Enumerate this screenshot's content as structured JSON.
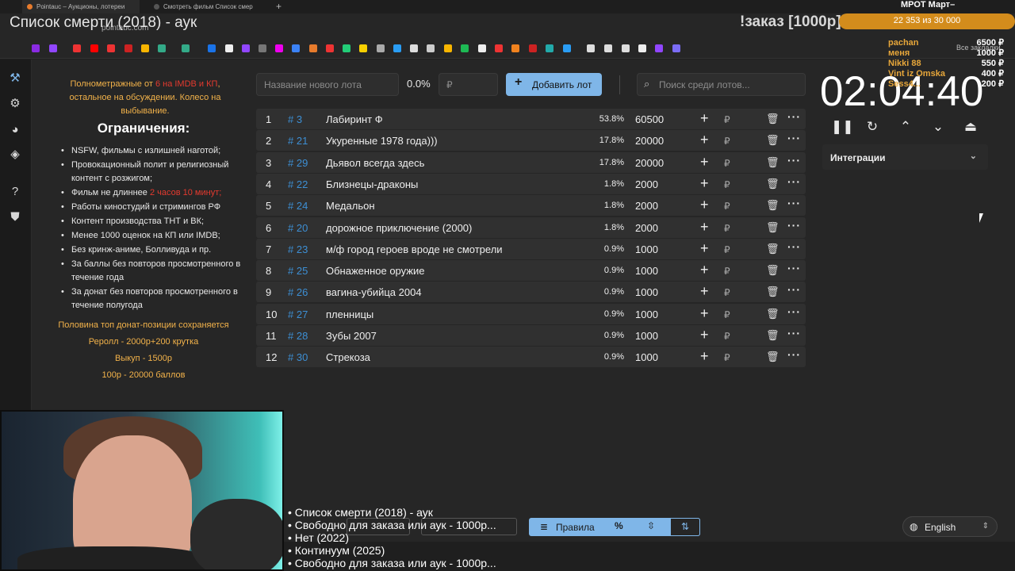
{
  "browser": {
    "tabs": [
      {
        "label": "Pointauc – Аукционы, лотереи"
      },
      {
        "label": "Смотреть фильм Список смер"
      }
    ],
    "url": "pointauc.com",
    "bookmarks_label": "Все закладки"
  },
  "overlay": {
    "page_title": "Список смерти (2018) - аук",
    "order": "!заказ [1000р]",
    "goal": "22 353  из 30 000",
    "mrot": "МРОТ Март–",
    "donors": [
      "pachan",
      "меня",
      "Nikki 88",
      "Vint iz Omska",
      "Sess4..."
    ],
    "donor_sums": [
      "6500 ₽",
      "1000 ₽",
      "550 ₽",
      "400 ₽",
      "200 ₽"
    ],
    "ticker": [
      "• Список смерти (2018) - аук",
      "• Свободно для заказа или аук - 1000р...",
      "• Нет (2022)",
      "• Континуум (2025)",
      "• Свободно для заказа или аук - 1000р..."
    ]
  },
  "rules": {
    "intro_a": "Полнометражные от ",
    "intro_red": "6 на IMDB и КП",
    "intro_b": ", остальное на обсуждении. Колесо на выбывание.",
    "title": "Ограничения:",
    "items": [
      "NSFW, фильмы с излишней наготой;",
      "Провокационный полит и религиозный контент с розжигом;",
      "Фильм не длиннее ",
      "Работы киностудий и стримингов РФ",
      "Контент производства ТНТ и ВК;",
      "Менее 1000 оценок на КП или IMDB;",
      "Без кринж-аниме, Болливуда и пр.",
      "За баллы без повторов просмотренного в течение года",
      "За донат без повторов просмотренного в течение полугода"
    ],
    "item3_red": "2 часов 10 минут;",
    "footer": [
      "Половина топ донат-позиции сохраняется",
      "Реролл - 2000р+200 крутка",
      "Выкуп - 1500р",
      "100р - 20000 баллов"
    ]
  },
  "controls": {
    "lot_name_placeholder": "Название нового лота",
    "percent": "0.0%",
    "amount_placeholder": "₽",
    "add_lot": "Добавить лот",
    "search_placeholder": "Поиск среди лотов..."
  },
  "lots": [
    {
      "idx": "1",
      "id": "# 3",
      "name": "Лабиринт Ф",
      "pct": "53.8%",
      "amount": "60500"
    },
    {
      "idx": "2",
      "id": "# 21",
      "name": "Укуренные 1978 года)))",
      "pct": "17.8%",
      "amount": "20000"
    },
    {
      "idx": "3",
      "id": "# 29",
      "name": "Дьявол всегда здесь",
      "pct": "17.8%",
      "amount": "20000"
    },
    {
      "idx": "4",
      "id": "# 22",
      "name": "Близнецы-драконы",
      "pct": "1.8%",
      "amount": "2000"
    },
    {
      "idx": "5",
      "id": "# 24",
      "name": "Медальон",
      "pct": "1.8%",
      "amount": "2000"
    },
    {
      "idx": "6",
      "id": "# 20",
      "name": "дорожное приключение (2000)",
      "pct": "1.8%",
      "amount": "2000"
    },
    {
      "idx": "7",
      "id": "# 23",
      "name": "м/ф город героев вроде не смотрели",
      "pct": "0.9%",
      "amount": "1000"
    },
    {
      "idx": "8",
      "id": "# 25",
      "name": "Обнаженное оружие",
      "pct": "0.9%",
      "amount": "1000"
    },
    {
      "idx": "9",
      "id": "# 26",
      "name": "вагина-убийца 2004",
      "pct": "0.9%",
      "amount": "1000"
    },
    {
      "idx": "10",
      "id": "# 27",
      "name": "пленницы",
      "pct": "0.9%",
      "amount": "1000"
    },
    {
      "idx": "11",
      "id": "# 28",
      "name": "Зубы 2007",
      "pct": "0.9%",
      "amount": "1000"
    },
    {
      "idx": "12",
      "id": "# 30",
      "name": "Стрекоза",
      "pct": "0.9%",
      "amount": "1000"
    }
  ],
  "timer": {
    "value": "02:04:40"
  },
  "integrations": {
    "label": "Интеграции"
  },
  "bottom": {
    "rules_label": "Правила",
    "language": "English"
  },
  "colors": {
    "accent": "#7fb6e8",
    "warning": "#f2b24a",
    "danger": "#e43a2f",
    "id_link": "#3d8fd4"
  }
}
